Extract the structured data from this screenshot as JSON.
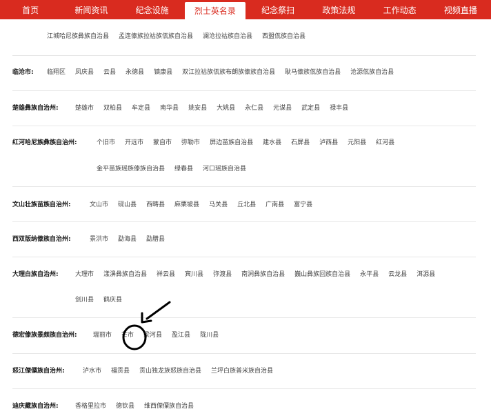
{
  "nav": {
    "items": [
      {
        "label": "首页"
      },
      {
        "label": "新闻资讯"
      },
      {
        "label": "纪念设施"
      },
      {
        "label": "烈士英名录",
        "active": true
      },
      {
        "label": "纪念祭扫"
      },
      {
        "label": "政策法规"
      },
      {
        "label": "工作动态"
      },
      {
        "label": "视频直播"
      }
    ]
  },
  "regions": [
    {
      "name": "",
      "lines": [
        [
          "江城哈尼族彝族自治县",
          "孟连傣族拉祜族佤族自治县",
          "澜沧拉祜族自治县",
          "西盟佤族自治县"
        ]
      ]
    },
    {
      "name": "临沧市:",
      "lines": [
        [
          "临翔区",
          "凤庆县",
          "云县",
          "永德县",
          "镇康县",
          "双江拉祜族佤族布朗族傣族自治县",
          "耿马傣族佤族自治县",
          "沧源佤族自治县"
        ]
      ]
    },
    {
      "name": "楚雄彝族自治州:",
      "lines": [
        [
          "楚雄市",
          "双柏县",
          "牟定县",
          "南华县",
          "姚安县",
          "大姚县",
          "永仁县",
          "元谋县",
          "武定县",
          "禄丰县"
        ]
      ]
    },
    {
      "name": "红河哈尼族彝族自治州:",
      "lines": [
        [
          "个旧市",
          "开远市",
          "蒙自市",
          "弥勒市",
          "屏边苗族自治县",
          "建水县",
          "石屏县",
          "泸西县",
          "元阳县",
          "红河县"
        ],
        [
          "金平苗族瑶族傣族自治县",
          "绿春县",
          "河口瑶族自治县"
        ]
      ]
    },
    {
      "name": "文山壮族苗族自治州:",
      "lines": [
        [
          "文山市",
          "砚山县",
          "西畴县",
          "麻栗坡县",
          "马关县",
          "丘北县",
          "广南县",
          "富宁县"
        ]
      ]
    },
    {
      "name": "西双版纳傣族自治州:",
      "lines": [
        [
          "景洪市",
          "勐海县",
          "勐腊县"
        ]
      ]
    },
    {
      "name": "大理白族自治州:",
      "lines": [
        [
          "大理市",
          "漾濞彝族自治县",
          "祥云县",
          "宾川县",
          "弥渡县",
          "南涧彝族自治县",
          "巍山彝族回族自治县",
          "永平县",
          "云龙县",
          "洱源县"
        ],
        [
          "剑川县",
          "鹤庆县"
        ]
      ]
    },
    {
      "name": "德宏傣族景颇族自治州:",
      "lines": [
        [
          "瑞丽市",
          "芒市",
          "梁河县",
          "盈江县",
          "陇川县"
        ]
      ]
    },
    {
      "name": "怒江傈僳族自治州:",
      "lines": [
        [
          "泸水市",
          "福贡县",
          "贡山独龙族怒族自治县",
          "兰坪白族普米族自治县"
        ]
      ]
    },
    {
      "name": "迪庆藏族自治州:",
      "lines": [
        [
          "香格里拉市",
          "德钦县",
          "维西傈僳族自治县"
        ]
      ]
    }
  ]
}
